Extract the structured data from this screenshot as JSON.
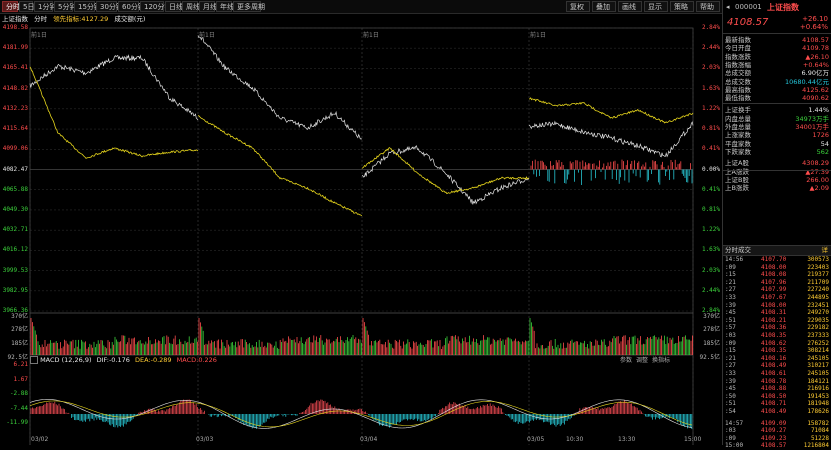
{
  "toolbar": {
    "tabs": [
      "分时",
      "5日",
      "1分钟",
      "5分钟",
      "15分钟",
      "30分钟",
      "60分钟",
      "120分钟",
      "日线",
      "周线",
      "月线",
      "年线",
      "更多周期"
    ],
    "active_tab": "分时",
    "right_buttons": [
      "复权",
      "叠加",
      "画线",
      "显示",
      "策略",
      "帮助"
    ]
  },
  "legend": {
    "title": "上证指数",
    "mode": "分时",
    "lead_label": "领先指标:4127.29",
    "vol_label": "成交额(元)"
  },
  "price_axis": {
    "left": [
      "4198.58",
      "4181.99",
      "4165.41",
      "4148.82",
      "4132.23",
      "4115.64",
      "4099.06",
      "4082.47",
      "4065.88",
      "4049.30",
      "4032.71",
      "4016.12",
      "3999.53",
      "3982.95",
      "3966.36"
    ],
    "right": [
      "2.84%",
      "2.44%",
      "2.03%",
      "1.63%",
      "1.22%",
      "0.81%",
      "0.41%",
      "0.00%",
      "0.41%",
      "0.81%",
      "1.22%",
      "1.63%",
      "2.03%",
      "2.44%",
      "2.84%"
    ]
  },
  "session_labels": [
    "前1日",
    "前1日",
    "前1日",
    "前1日",
    "前1日"
  ],
  "volume_axis": {
    "left": [
      "370亿",
      "278亿",
      "185亿",
      "92.5亿"
    ],
    "right": [
      "370亿",
      "278亿",
      "185亿",
      "92.5亿"
    ]
  },
  "macd": {
    "label": "MACD (12,26,9)",
    "dif": "DIF:-0.176",
    "dea": "DEA:-0.289",
    "macd": "MACD:0.226",
    "axis": [
      "6.21",
      "1.67",
      "-2.88",
      "-7.44",
      "-11.99"
    ],
    "tools": [
      "参数",
      "调整",
      "换指标"
    ]
  },
  "x_axis": [
    "03/02",
    "03/03",
    "03/04",
    "03/05",
    "10:30",
    "13:30",
    "15:00"
  ],
  "panel": {
    "code": "000001",
    "name": "上证指数",
    "price": "4108.57",
    "change": "+26.10",
    "change_pct": "+0.64%",
    "stats": [
      {
        "k": "最新指数",
        "v": "4108.57",
        "c": "red"
      },
      {
        "k": "今日开盘",
        "v": "4109.78",
        "c": "red"
      },
      {
        "k": "指数涨跌",
        "v": "▲26.10",
        "c": "red"
      },
      {
        "k": "指数涨幅",
        "v": "+0.64%",
        "c": "red"
      },
      {
        "k": "总成交额",
        "v": "6.90亿万",
        "c": "wht"
      },
      {
        "k": "总成交数",
        "v": "10680.44亿元",
        "c": "cyan"
      },
      {
        "k": "最高指数",
        "v": "4125.62",
        "c": "red"
      },
      {
        "k": "最低指数",
        "v": "4090.62",
        "c": "red"
      },
      {
        "k": "上证换手",
        "v": "1.44%",
        "c": "wht"
      },
      {
        "k": "内盘总量",
        "v": "34973万手",
        "c": "grn"
      },
      {
        "k": "外盘总量",
        "v": "34001万手",
        "c": "red"
      },
      {
        "k": "上涨家数",
        "v": "1726",
        "c": "red"
      },
      {
        "k": "平盘家数",
        "v": "54",
        "c": "wht"
      },
      {
        "k": "下跌家数",
        "v": "562",
        "c": "grn"
      },
      {
        "k": "上证A股",
        "v": "4308.29",
        "c": "red"
      },
      {
        "k": "上A涨跌",
        "v": "▲27.39",
        "c": "red"
      },
      {
        "k": "上证B股",
        "v": "266.00",
        "c": "red"
      },
      {
        "k": "上B涨跌",
        "v": "▲2.09",
        "c": "red"
      }
    ],
    "trades_title": "分时成交",
    "trades_btn": "详",
    "trades": [
      {
        "t": "14:56",
        "p": "4107.70",
        "v": "300573"
      },
      {
        "t": ":09",
        "p": "4108.00",
        "v": "223403"
      },
      {
        "t": ":15",
        "p": "4108.08",
        "v": "219377"
      },
      {
        "t": ":21",
        "p": "4107.96",
        "v": "211709"
      },
      {
        "t": ":27",
        "p": "4107.99",
        "v": "227240"
      },
      {
        "t": ":33",
        "p": "4107.67",
        "v": "244895"
      },
      {
        "t": ":39",
        "p": "4108.00",
        "v": "232451"
      },
      {
        "t": ":45",
        "p": "4108.31",
        "v": "249270"
      },
      {
        "t": ":51",
        "p": "4108.21",
        "v": "229035"
      },
      {
        "t": ":57",
        "p": "4108.36",
        "v": "229182"
      },
      {
        "t": ":03",
        "p": "4108.35",
        "v": "237333"
      },
      {
        "t": ":09",
        "p": "4108.62",
        "v": "276252"
      },
      {
        "t": ":15",
        "p": "4108.35",
        "v": "308214"
      },
      {
        "t": ":21",
        "p": "4108.16",
        "v": "245105"
      },
      {
        "t": ":27",
        "p": "4108.49",
        "v": "310217"
      },
      {
        "t": ":33",
        "p": "4108.61",
        "v": "245105"
      },
      {
        "t": ":39",
        "p": "4108.78",
        "v": "184121"
      },
      {
        "t": ":45",
        "p": "4108.88",
        "v": "216916"
      },
      {
        "t": ":50",
        "p": "4108.50",
        "v": "191453"
      },
      {
        "t": ":51",
        "p": "4108.71",
        "v": "181948"
      },
      {
        "t": ":54",
        "p": "4108.49",
        "v": "178626"
      },
      {
        "t": "14:57",
        "p": "4109.09",
        "v": "158782"
      },
      {
        "t": ":03",
        "p": "4109.27",
        "v": "71084"
      },
      {
        "t": ":09",
        "p": "4109.23",
        "v": "51228"
      },
      {
        "t": "15:00",
        "p": "4108.57",
        "v": "1216804"
      }
    ]
  },
  "colors": {
    "up": "#ff4d4d",
    "down": "#3cd23c",
    "price_line": "#e6e6e6",
    "avg_line": "#e6d51c",
    "macd_up": "#e8484f",
    "macd_down": "#27c4d1"
  }
}
